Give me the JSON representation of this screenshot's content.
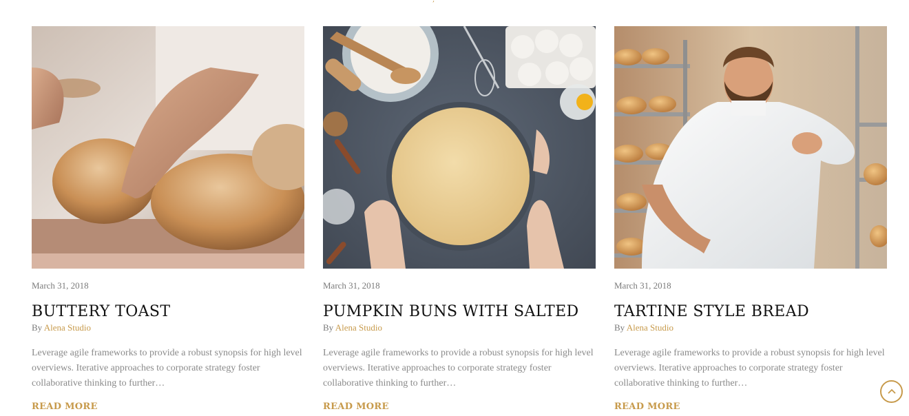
{
  "posts": [
    {
      "date": "March 31, 2018",
      "title": "BUTTERY TOAST",
      "by_label": "By",
      "author": "Alena Studio",
      "excerpt": "Leverage agile frameworks to provide a robust synopsis for high level overviews. Iterative approaches to corporate strategy foster collaborative thinking to further…",
      "read_more": "READ MORE"
    },
    {
      "date": "March 31, 2018",
      "title": "PUMPKIN BUNS WITH SALTED",
      "by_label": "By",
      "author": "Alena Studio",
      "excerpt": "Leverage agile frameworks to provide a robust synopsis for high level overviews. Iterative approaches to corporate strategy foster collaborative thinking to further…",
      "read_more": "READ MORE"
    },
    {
      "date": "March 31, 2018",
      "title": "TARTINE STYLE BREAD",
      "by_label": "By",
      "author": "Alena Studio",
      "excerpt": "Leverage agile frameworks to provide a robust synopsis for high level overviews. Iterative approaches to corporate strategy foster collaborative thinking to further…",
      "read_more": "READ MORE"
    }
  ],
  "colors": {
    "accent": "#c79a4b",
    "title": "#111111",
    "muted": "#7a7a7a"
  },
  "icons": {
    "back_to_top": "chevron-up-icon"
  }
}
